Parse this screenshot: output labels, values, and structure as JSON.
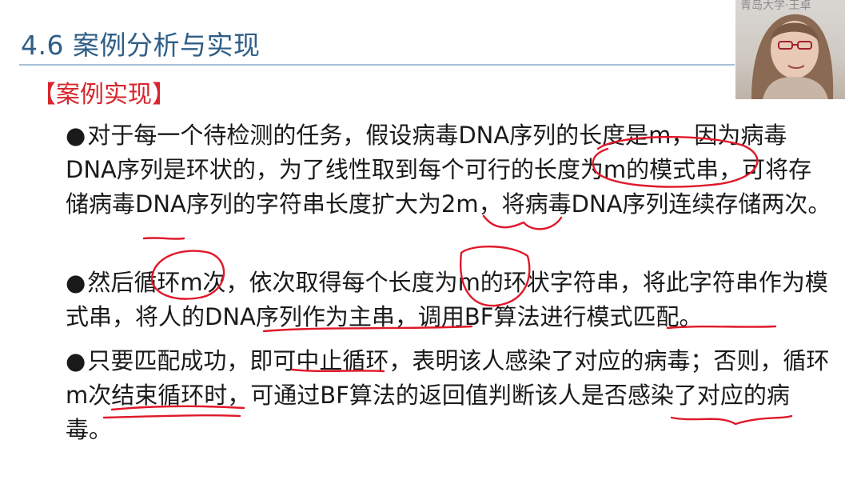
{
  "slide": {
    "title": "4.6 案例分析与实现",
    "section_heading": "【案例实现】",
    "bullet_symbol": "●",
    "paragraphs": [
      "对于每一个待检测的任务，假设病毒DNA序列的长度是m，因为病毒DNA序列是环状的，为了线性取到每个可行的长度为m的模式串，可将存储病毒DNA序列的字符串长度扩大为2m，将病毒DNA序列连续存储两次。",
      "然后循环m次，依次取得每个长度为m的环状字符串，将此字符串作为模式串，将人的DNA序列作为主串，调用BF算法进行模式匹配。",
      "只要匹配成功，即可中止循环，表明该人感染了对应的病毒；否则，循环m次结束循环时，可通过BF算法的返回值判断该人是否感染了对应的病毒。"
    ]
  },
  "webcam": {
    "caption": "青岛大学·王卓"
  },
  "colors": {
    "title": "#2f5e86",
    "heading": "#d8262c",
    "annotation_ink": "#e0182a"
  }
}
